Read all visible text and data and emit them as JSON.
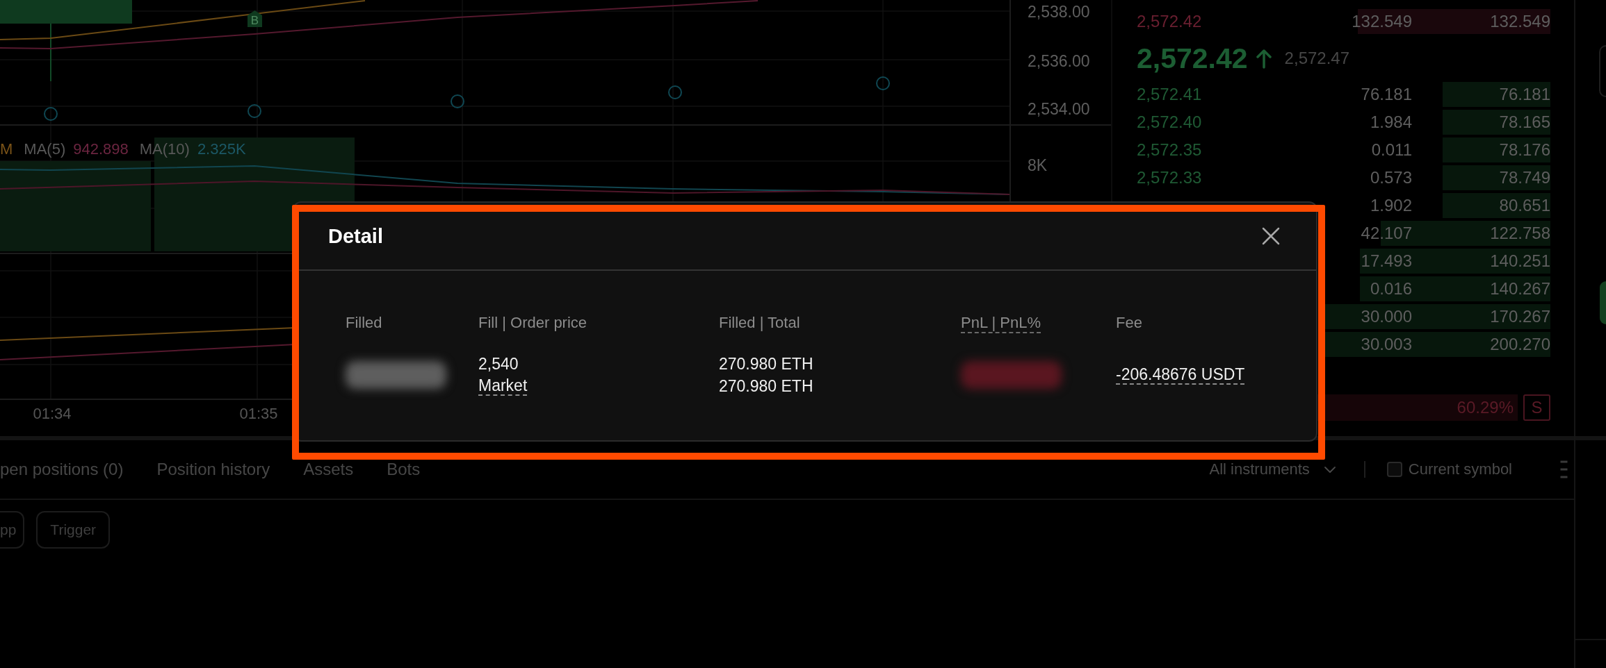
{
  "chart": {
    "price_ticks": [
      "2,538.00",
      "2,536.00",
      "2,534.00"
    ],
    "volume_ticks": [
      "8K"
    ],
    "time_ticks": [
      "01:34",
      "01:35"
    ],
    "trade_marker": {
      "label": "B"
    },
    "volume_legend": [
      {
        "value": "M",
        "color": "#7c5418"
      },
      {
        "label": "MA(5)",
        "value": "942.898",
        "color": "#6b2540"
      },
      {
        "label": "MA(10)",
        "value": "2.325K",
        "color": "#1c5866"
      }
    ]
  },
  "order_book": {
    "asks": [
      {
        "price": "2,572.42",
        "amount": "132.549",
        "total": "132.549",
        "level": 0.466
      }
    ],
    "last_price": "2,572.42",
    "last_price_rising": true,
    "reference_price": "2,572.47",
    "bids": [
      {
        "price": "2,572.41",
        "amount": "76.181",
        "total": "76.181",
        "level": 0.26
      },
      {
        "price": "2,572.40",
        "amount": "1.984",
        "total": "78.165",
        "level": 0.26
      },
      {
        "price": "2,572.35",
        "amount": "0.011",
        "total": "78.176",
        "level": 0.26
      },
      {
        "price": "2,572.33",
        "amount": "0.573",
        "total": "78.749",
        "level": 0.26
      },
      {
        "amount": "1.902",
        "total": "80.651",
        "level": 0.26
      },
      {
        "amount": "42.107",
        "total": "122.758",
        "level": 0.41
      },
      {
        "amount": "17.493",
        "total": "140.251",
        "level": 0.46
      },
      {
        "amount": "0.016",
        "total": "140.267",
        "level": 0.46
      },
      {
        "amount": "30.000",
        "total": "170.267",
        "level": 0.55
      },
      {
        "amount": "30.003",
        "total": "200.270",
        "level": 0.55
      }
    ],
    "ratio": {
      "percent": "60.29%",
      "label": "S",
      "level": 0.6029
    }
  },
  "detail_dialog": {
    "title": "Detail",
    "highlighted": true,
    "columns": [
      {
        "label": "Filled",
        "has_tooltip": false
      },
      {
        "label": "Fill | Order price",
        "has_tooltip": false
      },
      {
        "label": "Filled | Total",
        "has_tooltip": false
      },
      {
        "label": "PnL | PnL%",
        "has_tooltip": true
      },
      {
        "label": "Fee",
        "has_tooltip": false
      }
    ],
    "cells": [
      {
        "kind": "blurred",
        "color": "#5e5e5e"
      },
      {
        "kind": "text",
        "lines": [
          {
            "text": "2,540",
            "has_tooltip": false
          },
          {
            "text": "Market",
            "has_tooltip": true
          }
        ]
      },
      {
        "kind": "text",
        "lines": [
          {
            "text": "270.980 ETH",
            "has_tooltip": false
          },
          {
            "text": "270.980 ETH",
            "has_tooltip": false
          }
        ]
      },
      {
        "kind": "blurred",
        "color": "#5a1620"
      },
      {
        "kind": "text",
        "lines": [
          {
            "text": "-206.48676 USDT",
            "has_tooltip": true
          }
        ]
      }
    ]
  },
  "positions_panel": {
    "tabs": [
      {
        "label": "pen positions (0)",
        "selected": false
      },
      {
        "label": "Position history",
        "selected": false
      },
      {
        "label": "Assets",
        "selected": false
      },
      {
        "label": "Bots",
        "selected": false
      }
    ],
    "instrument_filter": "All instruments",
    "current_symbol": {
      "label": "Current symbol",
      "checked": false
    },
    "order_filters": [
      {
        "label": "pp",
        "selected": false
      },
      {
        "label": "Trigger",
        "selected": false
      }
    ]
  }
}
